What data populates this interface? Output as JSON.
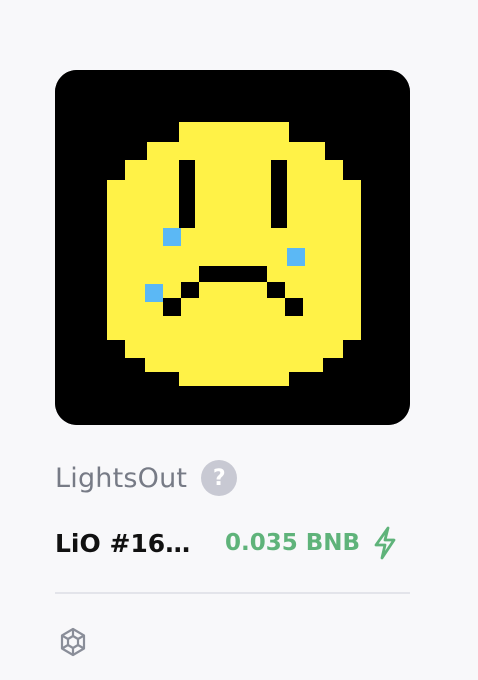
{
  "nft": {
    "image_icon": "crying-pixel-face-icon",
    "collection_name": "LightsOut",
    "help_icon_glyph": "?",
    "token_name": "LiO #16…",
    "price": "0.035 BNB",
    "price_color": "#5fb37a",
    "lightning_icon": "lightning-bolt-icon",
    "chain_icon": "bnb-chain-icon"
  },
  "colors": {
    "face": "#fff247",
    "tear": "#5bb8f5",
    "background": "#000000"
  }
}
